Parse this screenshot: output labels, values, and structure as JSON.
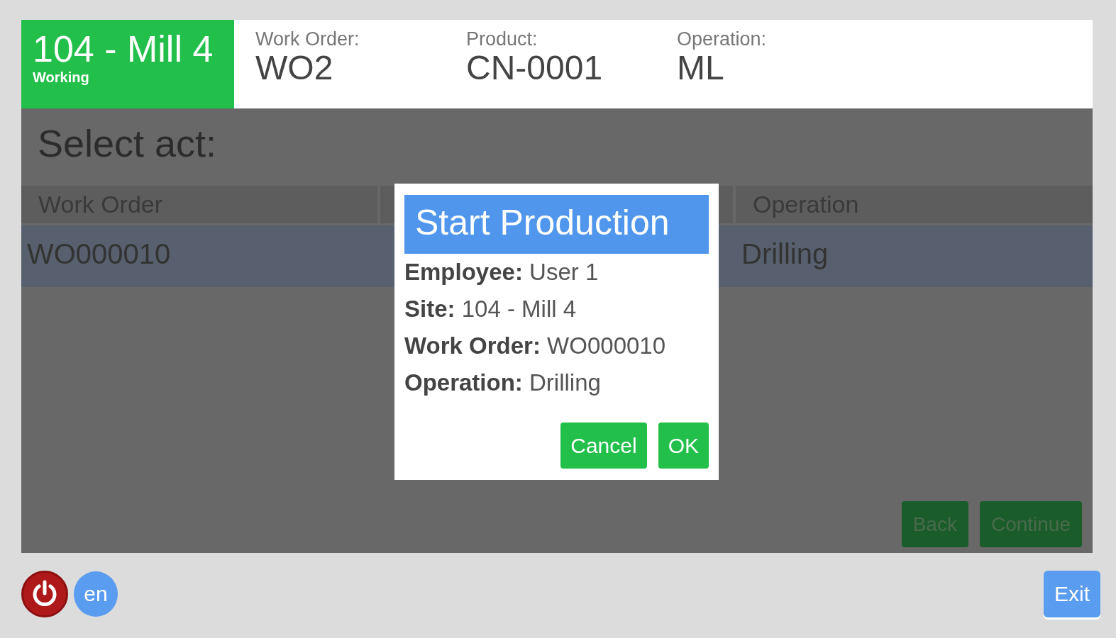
{
  "station": {
    "name": "104 - Mill 4",
    "status": "Working"
  },
  "header_fields": [
    {
      "label": "Work Order:",
      "value": "WO2"
    },
    {
      "label": "Product:",
      "value": "CN-0001"
    },
    {
      "label": "Operation:",
      "value": "ML"
    }
  ],
  "panel": {
    "title": "Select act:",
    "columns": [
      "Work Order",
      "",
      "Operation"
    ],
    "rows": [
      {
        "cells": [
          "WO000010",
          "",
          "Drilling"
        ],
        "selected": true
      }
    ],
    "actions": [
      "Back",
      "Continue"
    ]
  },
  "dialog": {
    "title": "Start Production",
    "fields": [
      {
        "label": "Employee:",
        "value": "User 1"
      },
      {
        "label": "Site:",
        "value": "104 - Mill 4"
      },
      {
        "label": "Work Order:",
        "value": "WO000010"
      },
      {
        "label": "Operation:",
        "value": "Drilling"
      }
    ],
    "buttons": [
      "Cancel",
      "OK"
    ]
  },
  "footer": {
    "language": "en",
    "exit": "Exit"
  }
}
